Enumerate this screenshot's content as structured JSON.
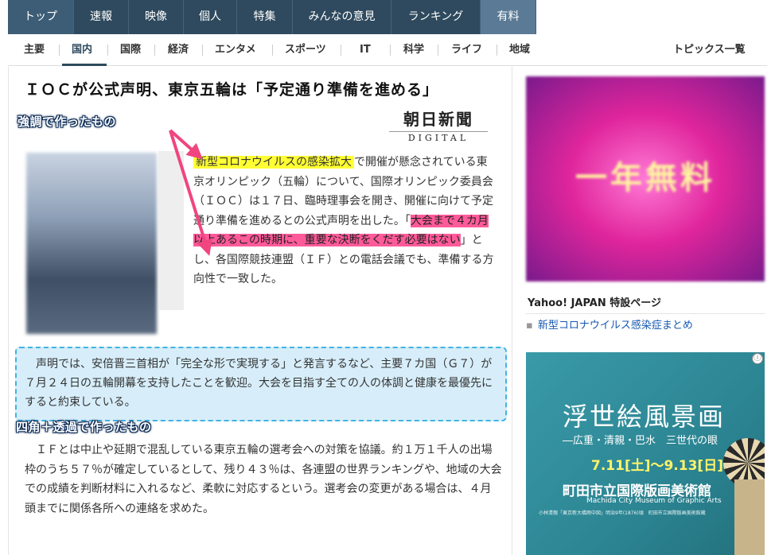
{
  "topnav": {
    "items": [
      {
        "label": "トップ"
      },
      {
        "label": "速報"
      },
      {
        "label": "映像"
      },
      {
        "label": "個人"
      },
      {
        "label": "特集"
      },
      {
        "label": "みんなの意見"
      },
      {
        "label": "ランキング"
      },
      {
        "label": "有料"
      }
    ]
  },
  "subnav": {
    "items": [
      {
        "label": "主要"
      },
      {
        "label": "国内"
      },
      {
        "label": "国際"
      },
      {
        "label": "経済"
      },
      {
        "label": "エンタメ"
      },
      {
        "label": "スポーツ"
      },
      {
        "label": "IT"
      },
      {
        "label": "科学"
      },
      {
        "label": "ライフ"
      },
      {
        "label": "地域"
      }
    ],
    "active": "国内",
    "topics_link": "トピックス一覧"
  },
  "article": {
    "headline": "ＩＯＣが公式声明、東京五輪は「予定通り準備を進める」",
    "source_logo": {
      "name": "朝日新聞",
      "sub": "DIGITAL"
    },
    "para1": {
      "highlight_yellow": "新型コロナウイルスの感染拡大",
      "text_a": "で開催が懸念されている東京オリンピック（五輪）について、国際オリンピック委員会（ＩＯＣ）は１７日、臨時理事会を開き、開催に向けて予定通り準備を進めるとの公式声明を出した。「",
      "highlight_pink": "大会まで４カ月以上あるこの時期に、重要な決断をくだす必要はない",
      "text_b": "」とし、各国際競技連盟（ＩＦ）との電話会議でも、準備する方向性で一致した。"
    },
    "para2": "声明では、安倍晋三首相が「完全な形で実現する」と発言するなど、主要７カ国（Ｇ７）が７月２４日の五輪開幕を支持したことを歓迎。大会を目指す全ての人の体調と健康を最優先にすると約束している。",
    "para3": "ＩＦとは中止や延期で混乱している東京五輪の選考会への対策を協議。約１万１千人の出場枠のうち５７％が確定しているとして、残り４３％は、各連盟の世界ランキングや、地域の大会での成績を判断材料に入れるなど、柔軟に対応するという。選考会の変更がある場合は、４月頭までに関係各所への連絡を求めた。"
  },
  "annotations": {
    "emphasis": "強調で作ったもの",
    "box": "四角＋透過で作ったもの",
    "arrow_color": "#f0457f"
  },
  "sidebar": {
    "ad1_text": "一年無料",
    "special_title": "Yahoo! JAPAN 特設ページ",
    "special_link": "新型コロナウイルス感染症まとめ",
    "ad2": {
      "info_icon": "ⓘ",
      "title": "浮世絵風景画",
      "subtitle": "―広重・清親・巴水　三世代の眼",
      "dates": "7.11[土]～9.13[日]",
      "museum": "町田市立国際版画美術館",
      "museum_en": "Machida City Museum of Graphic Arts",
      "note": "小林清親「東京新大橋雨中図」明治9年(1876)頃　町田市立国際版画美術館蔵"
    }
  },
  "colors": {
    "nav_bg": "#2f4a5e",
    "highlight_yellow": "#ffff33",
    "highlight_pink": "#ff5a9a",
    "box_border": "#41b3e3",
    "box_bg": "#d7eefa"
  }
}
